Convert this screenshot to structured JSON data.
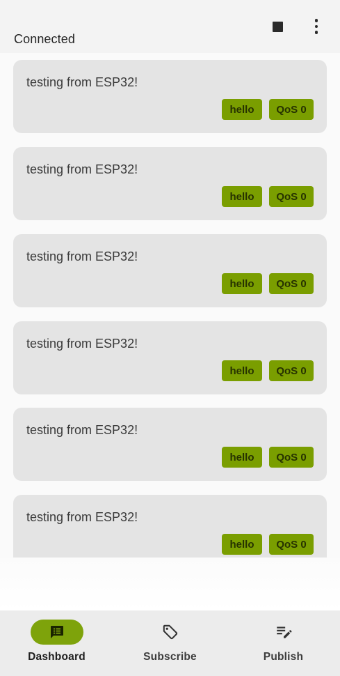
{
  "appbar": {
    "status": "Connected",
    "stop_icon": "stop-icon",
    "more_icon": "more-vert-icon"
  },
  "messages": [
    {
      "text": "testing from ESP32!",
      "topic": "hello",
      "qos": "QoS 0"
    },
    {
      "text": "testing from ESP32!",
      "topic": "hello",
      "qos": "QoS 0"
    },
    {
      "text": "testing from ESP32!",
      "topic": "hello",
      "qos": "QoS 0"
    },
    {
      "text": "testing from ESP32!",
      "topic": "hello",
      "qos": "QoS 0"
    },
    {
      "text": "testing from ESP32!",
      "topic": "hello",
      "qos": "QoS 0"
    },
    {
      "text": "testing from ESP32!",
      "topic": "hello",
      "qos": "QoS 0"
    }
  ],
  "bottom_nav": {
    "items": [
      {
        "label": "Dashboard",
        "icon": "message-list-icon",
        "active": true
      },
      {
        "label": "Subscribe",
        "icon": "tag-icon",
        "active": false
      },
      {
        "label": "Publish",
        "icon": "edit-note-icon",
        "active": false
      }
    ]
  },
  "colors": {
    "accent": "#7a9e00",
    "chip_text": "#263200",
    "card_bg": "#e4e4e4",
    "nav_bg": "#ececec"
  }
}
